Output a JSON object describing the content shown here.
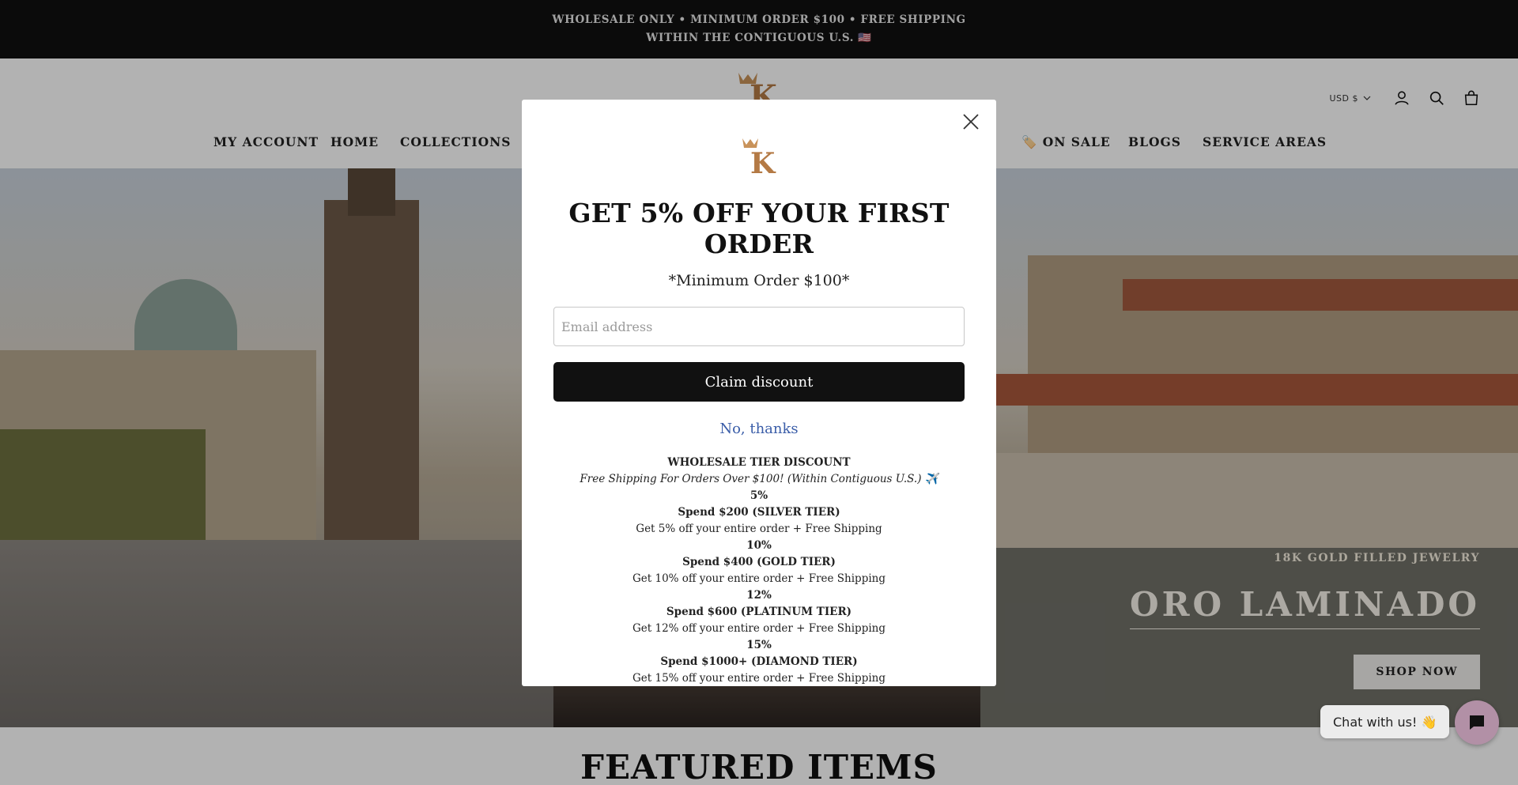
{
  "announcement": "WHOLESALE ONLY • MINIMUM ORDER $100 • FREE SHIPPING WITHIN THE CONTIGUOUS U.S. 🇺🇸",
  "header": {
    "currency": "USD $",
    "icons": [
      "account-icon",
      "search-icon",
      "cart-icon"
    ]
  },
  "nav": {
    "items": [
      "MY ACCOUNT",
      "HOME",
      "COLLECTIONS",
      "🏷️ ON SALE",
      "BLOGS",
      "SERVICE AREAS"
    ]
  },
  "hero": {
    "subtitle": "18K GOLD FILLED JEWELRY",
    "title": "ORO LAMINADO",
    "button": "SHOP NOW"
  },
  "featured": {
    "title": "FEATURED ITEMS"
  },
  "modal": {
    "title": "GET 5% OFF YOUR FIRST ORDER",
    "subtitle": "*Minimum Order $100*",
    "email_placeholder": "Email address",
    "claim_label": "Claim discount",
    "decline_label": "No, thanks",
    "tiers": {
      "heading": "WHOLESALE TIER DISCOUNT",
      "shipping_note": "Free Shipping For Orders Over $100! (Within Contiguous U.S.) ✈️",
      "rows": [
        {
          "pct": "5%",
          "tier": "Spend $200 (SILVER TIER)",
          "desc": "Get 5% off your entire order + Free Shipping"
        },
        {
          "pct": "10%",
          "tier": "Spend $400 (GOLD TIER)",
          "desc": "Get 10% off your entire order + Free Shipping"
        },
        {
          "pct": "12%",
          "tier": "Spend $600 (PLATINUM TIER)",
          "desc": "Get 12% off your entire order + Free Shipping"
        },
        {
          "pct": "15%",
          "tier": "Spend $1000+ (DIAMOND TIER)",
          "desc": "Get 15% off your entire order + Free Shipping"
        }
      ]
    }
  },
  "chat": {
    "label": "Chat with us! 👋"
  },
  "colors": {
    "announcement_bg": "#111111",
    "claim_button_bg": "#111111",
    "link_blue": "#3a5da8",
    "chat_accent": "#b290a6",
    "logo_gold": "#c8925a"
  }
}
